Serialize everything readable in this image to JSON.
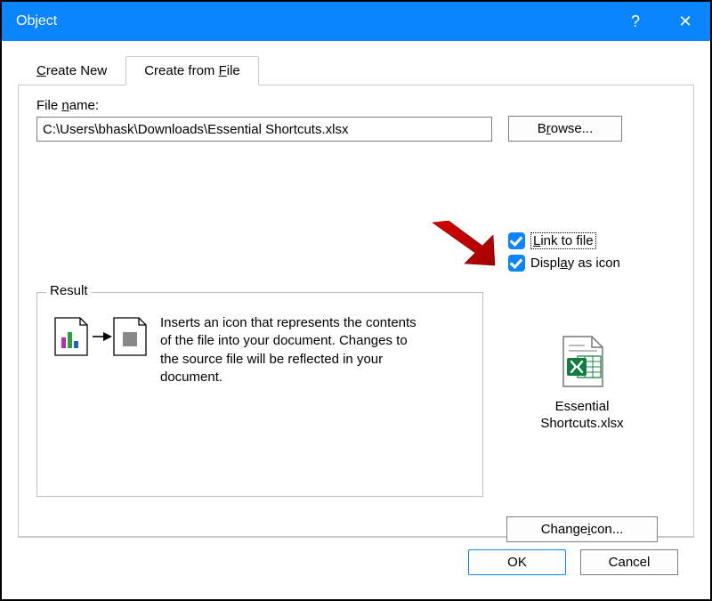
{
  "titlebar": {
    "title": "Object",
    "help_icon": "?",
    "close_icon": "✕"
  },
  "tabs": {
    "create_new": "Create New",
    "create_from_file": "Create from File"
  },
  "file": {
    "label_prefix": "File ",
    "label_underlined": "n",
    "label_suffix": "ame:",
    "value": "C:\\Users\\bhask\\Downloads\\Essential Shortcuts.xlsx"
  },
  "browse": {
    "prefix": "B",
    "underlined": "r",
    "suffix": "owse..."
  },
  "link_to_file": {
    "underlined": "L",
    "suffix": "ink to file"
  },
  "display_as_icon": {
    "prefix": "Displ",
    "underlined": "a",
    "suffix": "y as icon"
  },
  "result": {
    "legend": "Result",
    "text": "Inserts an icon that represents the contents of the file into your document. Changes to the source file will be reflected in your document."
  },
  "icon_preview": {
    "label_line1": "Essential",
    "label_line2": "Shortcuts.xlsx"
  },
  "change_icon": {
    "prefix": "Change ",
    "underlined": "i",
    "suffix": "con..."
  },
  "footer": {
    "ok": "OK",
    "cancel": "Cancel"
  }
}
